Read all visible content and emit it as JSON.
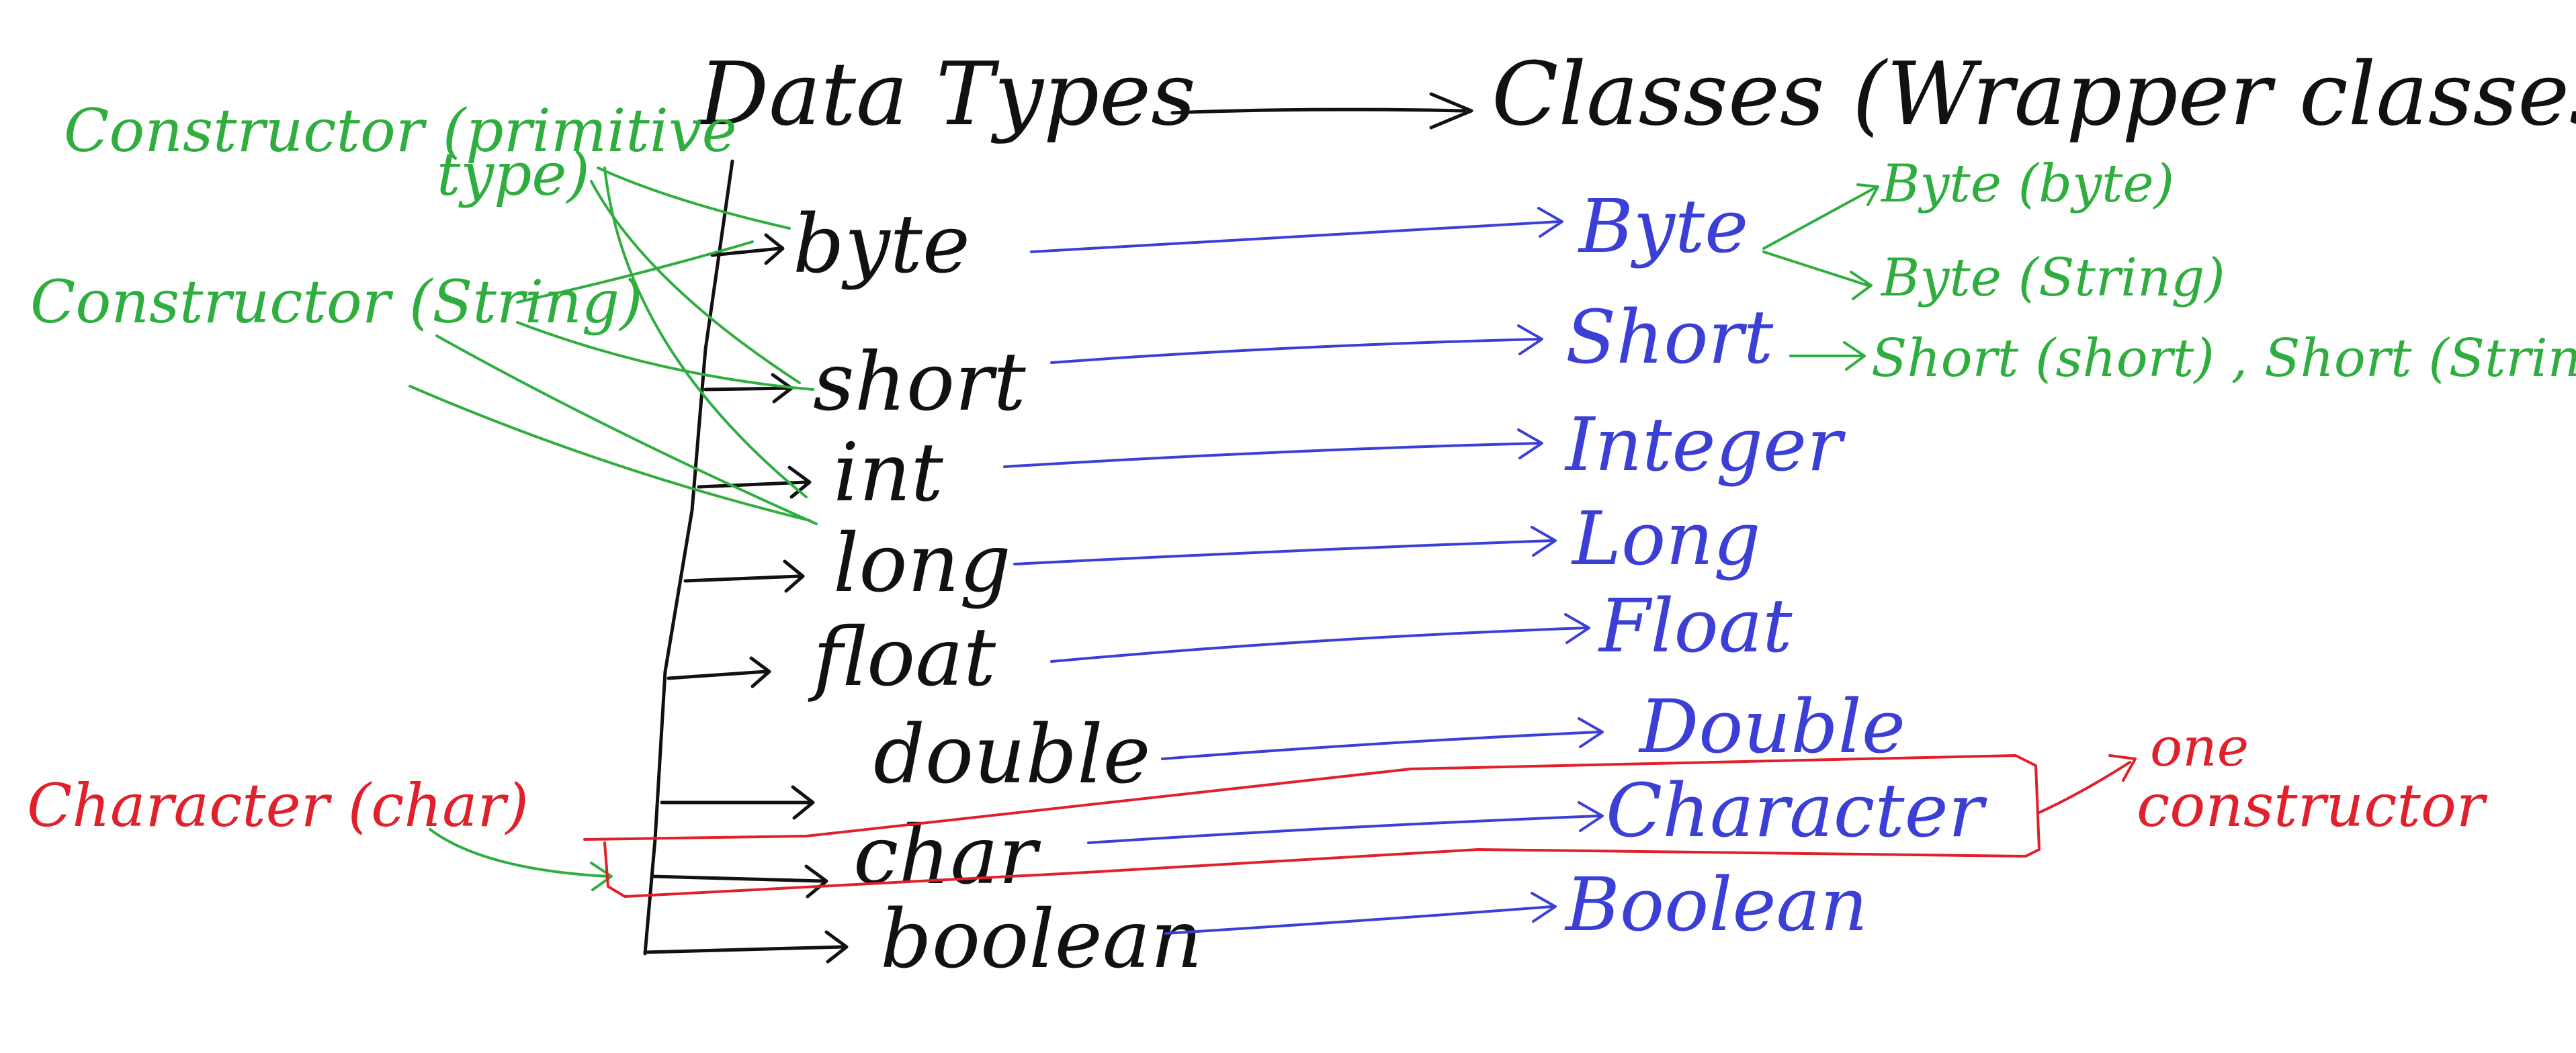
{
  "colors": {
    "black_ink": "#111111",
    "blue_ink": "#3b3fd6",
    "green_ink": "#2fae3f",
    "red_ink": "#e0202a"
  },
  "header": {
    "left": "Data Types",
    "right": "Classes (Wrapper classes)"
  },
  "primitives": [
    "byte",
    "short",
    "int",
    "long",
    "float",
    "double",
    "char",
    "boolean"
  ],
  "wrappers": [
    "Byte",
    "Short",
    "Integer",
    "Long",
    "Float",
    "Double",
    "Character",
    "Boolean"
  ],
  "notes": {
    "constructor_primitive": [
      "Constructor (primitive",
      "type)"
    ],
    "constructor_string": "Constructor (String)",
    "byte_ctor_1": "Byte (byte)",
    "byte_ctor_2": "Byte (String)",
    "short_ctors": "Short (short) , Short (String)",
    "character_char": "Character (char)",
    "one_constructor": [
      "one",
      "constructor"
    ]
  }
}
